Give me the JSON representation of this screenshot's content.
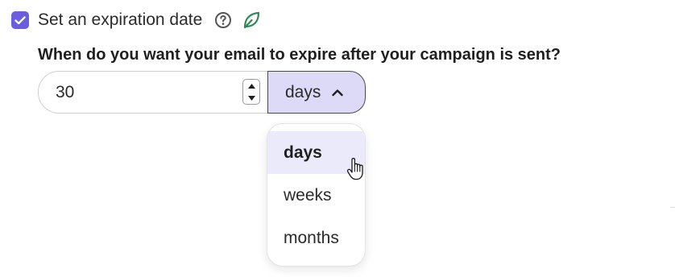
{
  "expiration": {
    "checkbox_checked": true,
    "checkbox_label": "Set an expiration date",
    "help_icon": "question-circle-icon",
    "eco_icon": "leaf-icon"
  },
  "question": {
    "text": "When do you want your email to expire after your campaign is sent?"
  },
  "duration": {
    "value": "30",
    "unit_selected": "days",
    "unit_options": [
      {
        "label": "days",
        "selected": true
      },
      {
        "label": "weeks",
        "selected": false
      },
      {
        "label": "months",
        "selected": false
      }
    ]
  },
  "colors": {
    "accent": "#6c5ce0",
    "select_bg": "#dcdaf6",
    "option_highlight": "#ebeafb",
    "leaf": "#2e8b57"
  }
}
